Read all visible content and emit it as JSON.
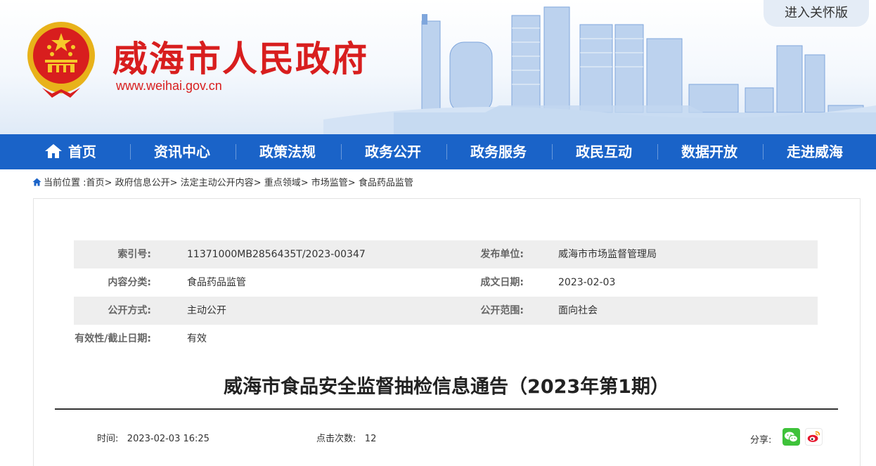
{
  "header": {
    "site_title": "威海市人民政府",
    "site_url": "www.weihai.gov.cn",
    "care_mode_label": "进入关怀版"
  },
  "nav": {
    "items": [
      {
        "label": "首页",
        "icon": "home-icon"
      },
      {
        "label": "资讯中心"
      },
      {
        "label": "政策法规"
      },
      {
        "label": "政务公开"
      },
      {
        "label": "政务服务"
      },
      {
        "label": "政民互动"
      },
      {
        "label": "数据开放"
      },
      {
        "label": "走进威海"
      }
    ]
  },
  "breadcrumb": {
    "prefix": "当前位置 :",
    "items": [
      "首页",
      "政府信息公开",
      "法定主动公开内容",
      "重点领域",
      "市场监管",
      "食品药品监管"
    ],
    "separator": ">"
  },
  "meta": {
    "index_label": "索引号:",
    "index_value": "11371000MB2856435T/2023-00347",
    "publisher_label": "发布单位:",
    "publisher_value": "威海市市场监督管理局",
    "category_label": "内容分类:",
    "category_value": "食品药品监管",
    "date_label": "成文日期:",
    "date_value": "2023-02-03",
    "method_label": "公开方式:",
    "method_value": "主动公开",
    "scope_label": "公开范围:",
    "scope_value": "面向社会",
    "validity_label": "有效性/截止日期:",
    "validity_value": "有效"
  },
  "article": {
    "title": "威海市食品安全监督抽检信息通告（2023年第1期）",
    "time_label": "时间:",
    "time_value": "2023-02-03 16:25",
    "clicks_label": "点击次数:",
    "clicks_value": "12",
    "share_label": "分享:"
  },
  "colors": {
    "brand_red": "#d81e1e",
    "nav_blue": "#1a63c8",
    "wechat_green": "#3ec23a",
    "weibo_red": "#e6162d"
  }
}
